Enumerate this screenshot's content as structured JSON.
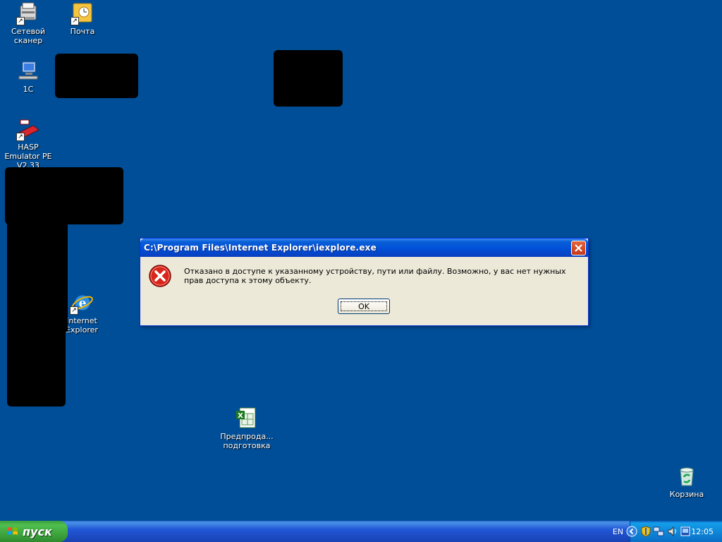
{
  "desktop": {
    "icons": [
      {
        "label": "Сетевой сканер"
      },
      {
        "label": "Почта"
      },
      {
        "label": "1С"
      },
      {
        "label": "HASP Emulator PE V2.33"
      },
      {
        "label": "Internet Explorer"
      },
      {
        "label": "Предпрода... подготовка"
      },
      {
        "label": "Корзина"
      }
    ]
  },
  "dialog": {
    "title": "C:\\Program Files\\Internet Explorer\\iexplore.exe",
    "message": "Отказано в доступе к указанному устройству, пути или файлу. Возможно,  у вас нет нужных прав доступа к этому объекту.",
    "ok_label": "OK"
  },
  "taskbar": {
    "start_label": "пуск",
    "language": "EN",
    "clock": "12:05"
  },
  "colors": {
    "desktop_bg": "#004e98",
    "title_blue": "#0050d8",
    "dialog_face": "#ece9d8",
    "start_green": "#3c9e3c"
  }
}
